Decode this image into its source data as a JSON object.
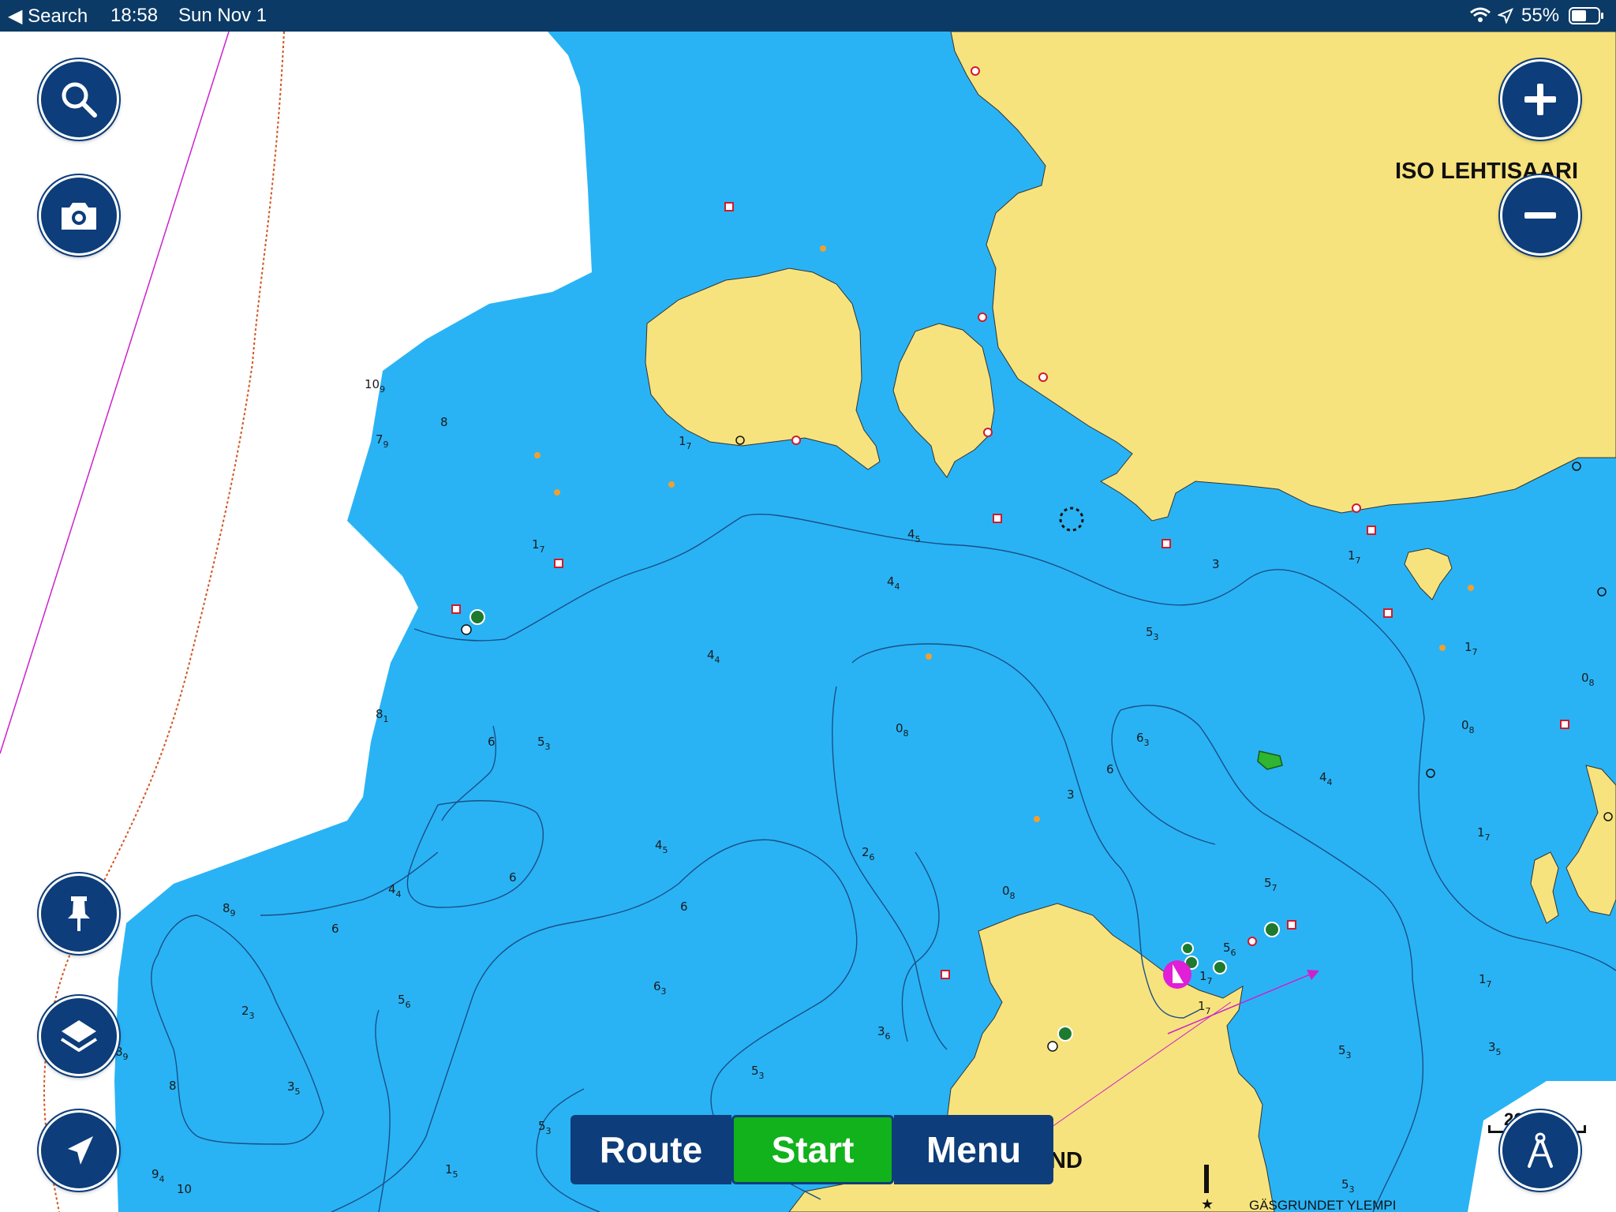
{
  "status_bar": {
    "back_label": "◀ Search",
    "time": "18:58",
    "date": "Sun Nov 1",
    "battery_percent": "55%"
  },
  "map": {
    "place_labels": {
      "island_name": "ISO LEHTISAARI",
      "partial_name": "ND",
      "bottom_name": "GÄSGRUNDET YLEMPI"
    },
    "colors": {
      "water": "#29b3f5",
      "land": "#f7e37d",
      "shallow_area": "#ffffff",
      "contour": "#1b4f86",
      "route_line": "#cc22cc"
    },
    "depth_soundings": [
      {
        "main": "10",
        "sub": "9"
      },
      {
        "main": "8",
        "sub": ""
      },
      {
        "main": "7",
        "sub": "9"
      },
      {
        "main": "1",
        "sub": "7"
      },
      {
        "main": "1",
        "sub": "7"
      },
      {
        "main": "4",
        "sub": "5"
      },
      {
        "main": "4",
        "sub": "4"
      },
      {
        "main": "3",
        "sub": ""
      },
      {
        "main": "5",
        "sub": "3"
      },
      {
        "main": "4",
        "sub": "4"
      },
      {
        "main": "0",
        "sub": "8"
      },
      {
        "main": "8",
        "sub": "1"
      },
      {
        "main": "6",
        "sub": ""
      },
      {
        "main": "5",
        "sub": "3"
      },
      {
        "main": "6",
        "sub": "3"
      },
      {
        "main": "6",
        "sub": ""
      },
      {
        "main": "3",
        "sub": ""
      },
      {
        "main": "4",
        "sub": "4"
      },
      {
        "main": "4",
        "sub": "5"
      },
      {
        "main": "2",
        "sub": "6"
      },
      {
        "main": "0",
        "sub": "8"
      },
      {
        "main": "5",
        "sub": "7"
      },
      {
        "main": "6",
        "sub": ""
      },
      {
        "main": "4",
        "sub": "4"
      },
      {
        "main": "6",
        "sub": ""
      },
      {
        "main": "8",
        "sub": "9"
      },
      {
        "main": "6",
        "sub": ""
      },
      {
        "main": "5",
        "sub": "6"
      },
      {
        "main": "2",
        "sub": "3"
      },
      {
        "main": "6",
        "sub": "3"
      },
      {
        "main": "3",
        "sub": "6"
      },
      {
        "main": "5",
        "sub": "6"
      },
      {
        "main": "1",
        "sub": "7"
      },
      {
        "main": "8",
        "sub": "9"
      },
      {
        "main": "8",
        "sub": ""
      },
      {
        "main": "3",
        "sub": "5"
      },
      {
        "main": "5",
        "sub": "3"
      },
      {
        "main": "5",
        "sub": "3"
      },
      {
        "main": "9",
        "sub": "4"
      },
      {
        "main": "1",
        "sub": "5"
      },
      {
        "main": "10",
        "sub": ""
      },
      {
        "main": "5",
        "sub": "3"
      },
      {
        "main": "3",
        "sub": "5"
      },
      {
        "main": "1",
        "sub": "7"
      },
      {
        "main": "1",
        "sub": "7"
      },
      {
        "main": "0",
        "sub": "8"
      },
      {
        "main": "0",
        "sub": "8"
      },
      {
        "main": "1",
        "sub": "7"
      },
      {
        "main": "1",
        "sub": "7"
      },
      {
        "main": "5",
        "sub": "3"
      },
      {
        "main": "1",
        "sub": "7"
      }
    ],
    "scale": {
      "value": "260",
      "unit": "ft"
    }
  },
  "controls": {
    "left": [
      {
        "name": "search-button",
        "icon": "search-icon"
      },
      {
        "name": "camera-button",
        "icon": "camera-icon"
      },
      {
        "name": "pin-button",
        "icon": "pin-icon"
      },
      {
        "name": "layers-button",
        "icon": "layers-icon"
      },
      {
        "name": "locate-button",
        "icon": "navigation-arrow-icon"
      }
    ],
    "right": [
      {
        "name": "zoom-in-button",
        "icon": "plus-icon"
      },
      {
        "name": "zoom-out-button",
        "icon": "minus-icon"
      },
      {
        "name": "tools-button",
        "icon": "compass-tool-icon"
      }
    ]
  },
  "bottom_bar": {
    "route_label": "Route",
    "start_label": "Start",
    "menu_label": "Menu"
  }
}
